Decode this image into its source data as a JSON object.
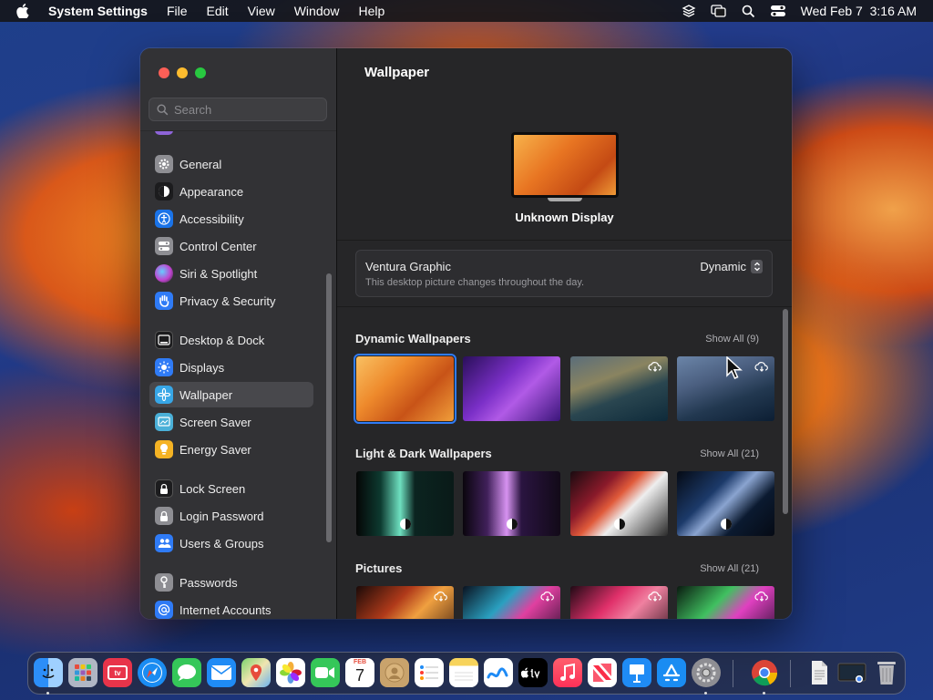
{
  "menubar": {
    "app_name": "System Settings",
    "menus": [
      "File",
      "Edit",
      "View",
      "Window",
      "Help"
    ],
    "datetime": "Wed Feb 7  3:16 AM"
  },
  "search": {
    "placeholder": "Search"
  },
  "sidebar": {
    "items": [
      {
        "label": "General",
        "icon": "gear-icon",
        "color": "#8e8e93"
      },
      {
        "label": "Appearance",
        "icon": "appearance-icon",
        "color": "#1c1c1e"
      },
      {
        "label": "Accessibility",
        "icon": "accessibility-icon",
        "color": "#1a73e8"
      },
      {
        "label": "Control Center",
        "icon": "control-center-icon",
        "color": "#8e8e93"
      },
      {
        "label": "Siri & Spotlight",
        "icon": "siri-icon",
        "color": "#c044d0"
      },
      {
        "label": "Privacy & Security",
        "icon": "hand-icon",
        "color": "#2f7bf6"
      },
      {
        "label": "Desktop & Dock",
        "icon": "dock-icon",
        "color": "#1c1c1e"
      },
      {
        "label": "Displays",
        "icon": "sun-icon",
        "color": "#2f7bf6"
      },
      {
        "label": "Wallpaper",
        "icon": "flower-icon",
        "color": "#37a6e6"
      },
      {
        "label": "Screen Saver",
        "icon": "screen-saver-icon",
        "color": "#4ab0d8"
      },
      {
        "label": "Energy Saver",
        "icon": "lightbulb-icon",
        "color": "#f5b324"
      },
      {
        "label": "Lock Screen",
        "icon": "lock-icon",
        "color": "#1c1c1e"
      },
      {
        "label": "Login Password",
        "icon": "padlock-icon",
        "color": "#8e8e93"
      },
      {
        "label": "Users & Groups",
        "icon": "users-icon",
        "color": "#2f7bf6"
      },
      {
        "label": "Passwords",
        "icon": "key-icon",
        "color": "#8e8e93"
      },
      {
        "label": "Internet Accounts",
        "icon": "at-icon",
        "color": "#2f7bf6"
      }
    ],
    "selected": "Wallpaper"
  },
  "content": {
    "title": "Wallpaper",
    "display_name": "Unknown Display",
    "current_wallpaper": {
      "name": "Ventura Graphic",
      "description": "This desktop picture changes throughout the day.",
      "mode": "Dynamic"
    },
    "sections": [
      {
        "title": "Dynamic Wallpapers",
        "show_all": "Show All (9)"
      },
      {
        "title": "Light & Dark Wallpapers",
        "show_all": "Show All (21)"
      },
      {
        "title": "Pictures",
        "show_all": "Show All (21)"
      }
    ]
  },
  "dock": {
    "apps": [
      "Finder",
      "Launchpad",
      "TV",
      "Safari",
      "Messages",
      "Mail",
      "Maps",
      "Photos",
      "FaceTime",
      "Calendar",
      "Contacts",
      "Reminders",
      "Notes",
      "Freeform",
      "Apple TV",
      "Music",
      "News",
      "Keynote",
      "App Store",
      "System Settings",
      "Google Chrome",
      "Document",
      "Screenshot",
      "Trash"
    ],
    "calendar_month": "FEB",
    "calendar_day": "7",
    "tv_label": "tv"
  }
}
